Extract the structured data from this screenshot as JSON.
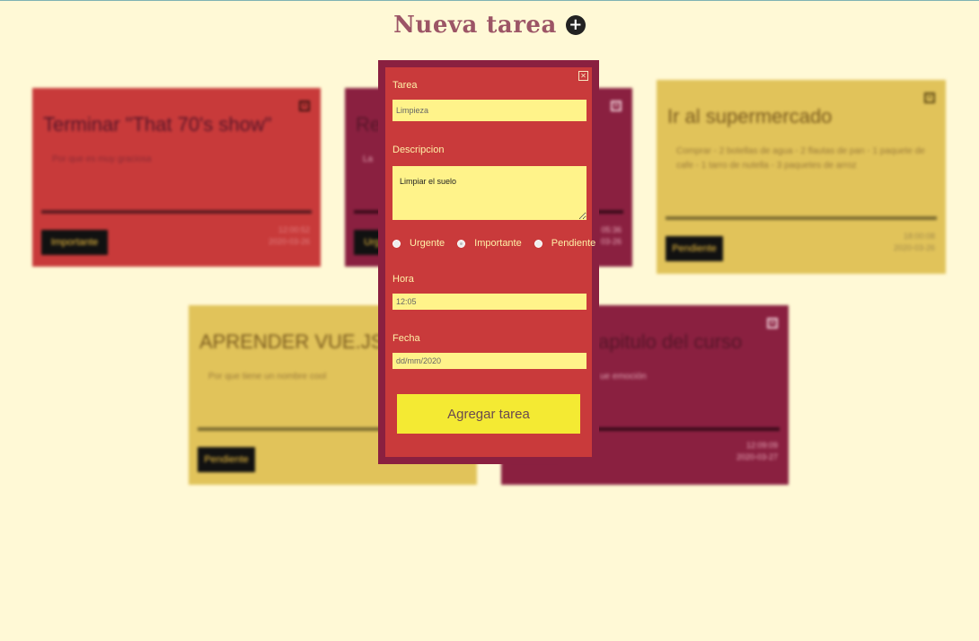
{
  "header": {
    "title": "Nueva tarea",
    "add_icon": "+"
  },
  "cards": [
    {
      "title": "Terminar \"That 70's show\"",
      "description": "Por que es muy graciosa",
      "badge": "Importante",
      "time": "12:00:52",
      "date": "2020-03-26",
      "close": "✕"
    },
    {
      "title": "Re",
      "description": "La",
      "badge": "Urg",
      "time": "05:36",
      "date": "03-26",
      "close": "✕"
    },
    {
      "title": "Ir al supermercado",
      "description": "Comprar - 2 botellas de agua - 2 flautas de pan - 1 paquete de cafe - 1 tarro de nutella - 3 paquetes de arroz",
      "badge": "Pendiente",
      "time": "18:00:08",
      "date": "2020-03-26",
      "close": "✕"
    },
    {
      "title": "APRENDER VUE.JS",
      "description": "Por que tiene un nombre cool",
      "badge": "Pendiente",
      "time": "",
      "date": "",
      "close": "✕"
    },
    {
      "title": "apitulo del curso",
      "description": "ue emoción",
      "badge": "",
      "time": "12:09:09",
      "date": "2020-03-27",
      "close": "✕"
    }
  ],
  "form": {
    "close": "✕",
    "task_label": "Tarea",
    "task_value": "Limpieza",
    "description_label": "Descripcion",
    "description_value": "Limpiar el suelo",
    "priority_options": [
      "Urgente",
      "Importante",
      "Pendiente"
    ],
    "priority_selected": "Importante",
    "hour_label": "Hora",
    "hour_value": "12:05",
    "date_label": "Fecha",
    "date_value": "dd/mm/2020",
    "submit_label": "Agregar tarea"
  },
  "colors": {
    "background": "#fff9d6",
    "card_red": "#c83a3a",
    "card_wine": "#8a2040",
    "card_yellow": "#e1c35a",
    "input_yellow": "#fff38a",
    "button_yellow": "#f4ea33"
  }
}
